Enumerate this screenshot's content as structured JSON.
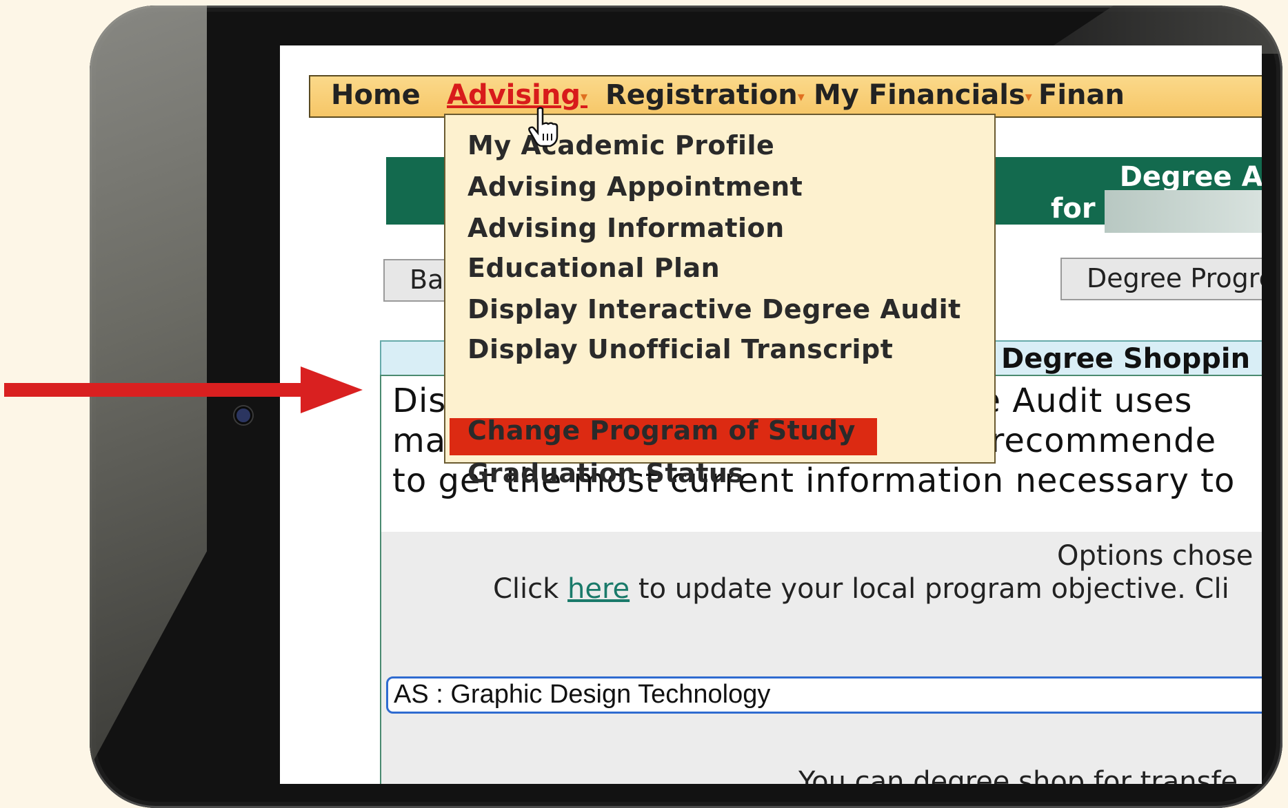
{
  "nav": {
    "items": [
      {
        "label": "Home",
        "has_caret": false
      },
      {
        "label": "Advising",
        "has_caret": true,
        "active": true
      },
      {
        "label": "Registration",
        "has_caret": true
      },
      {
        "label": "My Financials",
        "has_caret": true
      },
      {
        "label": "Finan",
        "has_caret": false
      }
    ],
    "caret_glyph": "▾"
  },
  "dropdown": {
    "items": [
      "My Academic Profile",
      "Advising Appointment",
      "Advising Information",
      "Educational Plan",
      "Display Interactive Degree Audit",
      "Display Unofficial Transcript",
      "Change Program of Study",
      "Graduation Status"
    ],
    "highlighted_index": 6,
    "highlight_color": "#dc2a12"
  },
  "banner": {
    "title": "Degree Au",
    "for_label": "for"
  },
  "buttons": {
    "back_label": "Ba",
    "degree_progress_label": "Degree Progre"
  },
  "degree_shopping": {
    "title": "Degree Shoppin",
    "desc_line1_left": "Dis",
    "desc_line1_right": "ee Audit uses",
    "desc_line2_left": "ma",
    "desc_line2_right": "y recommende",
    "desc_line3": "to get the most current information necessary to"
  },
  "options": {
    "chosen_label": "Options chose",
    "update_prefix": "Click ",
    "update_link": "here",
    "update_suffix": " to update your local program objective. Cli",
    "program_value": "AS : Graphic Design Technology",
    "transfer_text": "You can degree shop for transfe"
  },
  "colors": {
    "nav_bg": "#f6c667",
    "banner_bg": "#136a4e",
    "active_nav": "#d81b1b",
    "arrow": "#d92020",
    "page_bg": "#fdf6e7"
  },
  "icons": {
    "cursor": "hand-pointer-icon",
    "arrow": "red-arrow-icon",
    "camera": "camera-icon",
    "home_button": "home-button-icon"
  }
}
